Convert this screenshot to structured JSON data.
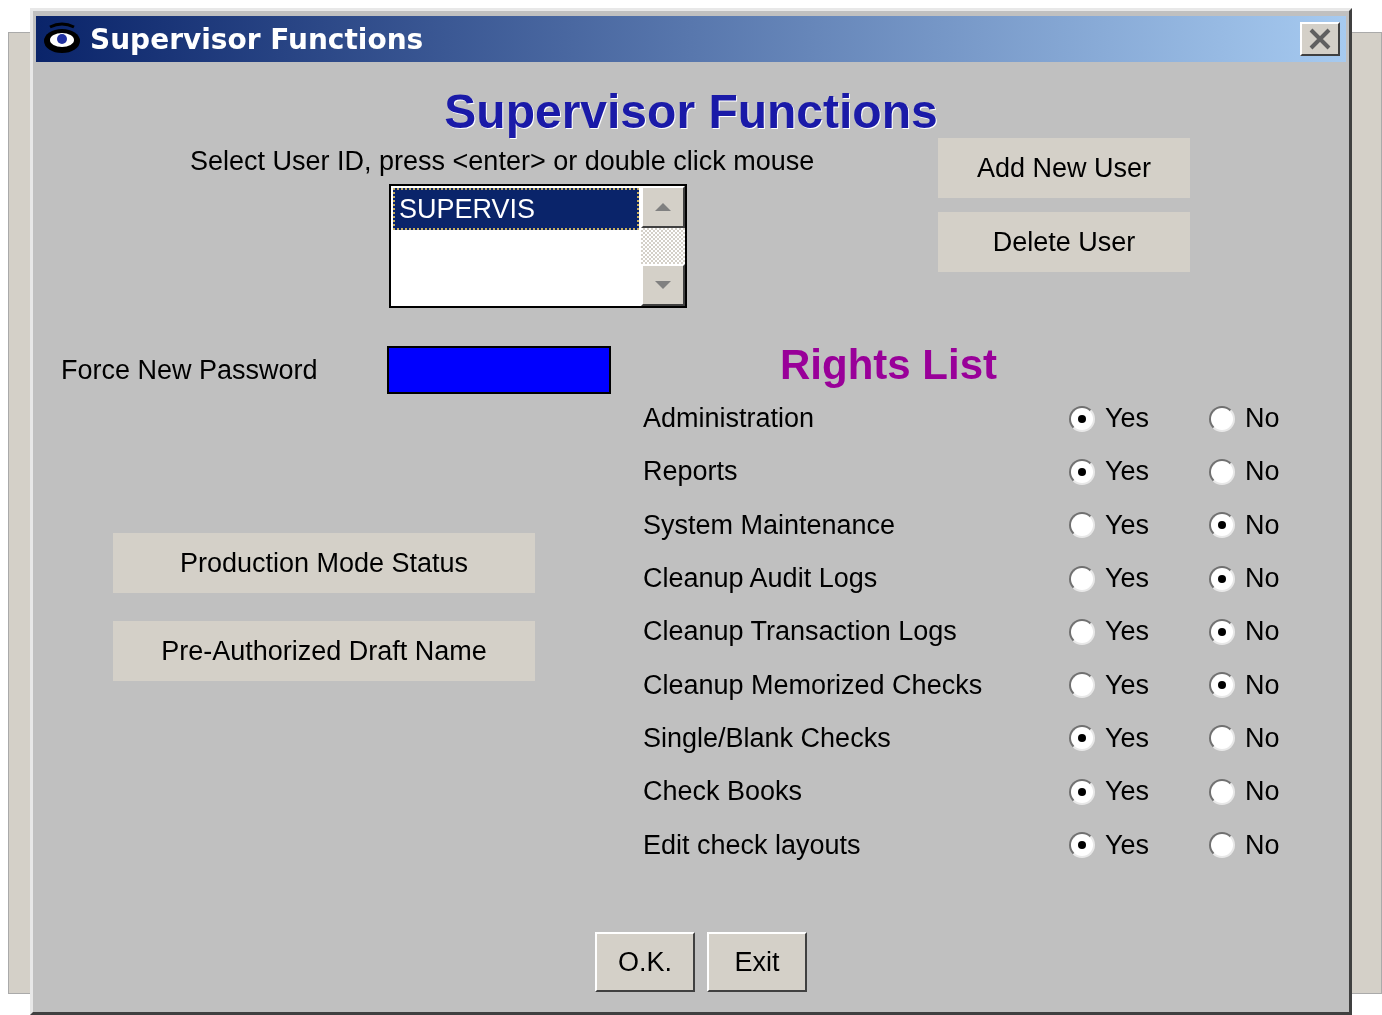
{
  "window": {
    "title": "Supervisor Functions"
  },
  "heading": "Supervisor Functions",
  "instruction": "Select User ID, press <enter> or double click mouse",
  "user_list": [
    {
      "label": "SUPERVIS",
      "selected": true
    }
  ],
  "user_buttons": [
    "Add New User",
    "Delete User"
  ],
  "force_password": {
    "label": "Force New Password",
    "color": "#0000ff"
  },
  "side_buttons": [
    "Production Mode Status",
    "Pre-Authorized Draft Name"
  ],
  "rights_title": "Rights List",
  "rights": [
    {
      "label": "Administration",
      "options": [
        {
          "label": "Yes",
          "selected": true
        },
        {
          "label": "No",
          "selected": false
        }
      ]
    },
    {
      "label": "Reports",
      "options": [
        {
          "label": "Yes",
          "selected": true
        },
        {
          "label": "No",
          "selected": false
        }
      ]
    },
    {
      "label": "System Maintenance",
      "options": [
        {
          "label": "Yes",
          "selected": false
        },
        {
          "label": "No",
          "selected": true
        }
      ]
    },
    {
      "label": "Cleanup Audit Logs",
      "options": [
        {
          "label": "Yes",
          "selected": false
        },
        {
          "label": "No",
          "selected": true
        }
      ]
    },
    {
      "label": "Cleanup Transaction Logs",
      "options": [
        {
          "label": "Yes",
          "selected": false
        },
        {
          "label": "No",
          "selected": true
        }
      ]
    },
    {
      "label": "Cleanup Memorized Checks",
      "options": [
        {
          "label": "Yes",
          "selected": false
        },
        {
          "label": "No",
          "selected": true
        }
      ]
    },
    {
      "label": "Single/Blank Checks",
      "options": [
        {
          "label": "Yes",
          "selected": true
        },
        {
          "label": "No",
          "selected": false
        }
      ]
    },
    {
      "label": "Check Books",
      "options": [
        {
          "label": "Yes",
          "selected": true
        },
        {
          "label": "No",
          "selected": false
        }
      ]
    },
    {
      "label": "Edit check layouts",
      "options": [
        {
          "label": "Yes",
          "selected": true
        },
        {
          "label": "No",
          "selected": false
        }
      ]
    }
  ],
  "footer_buttons": [
    "O.K.",
    "Exit"
  ]
}
